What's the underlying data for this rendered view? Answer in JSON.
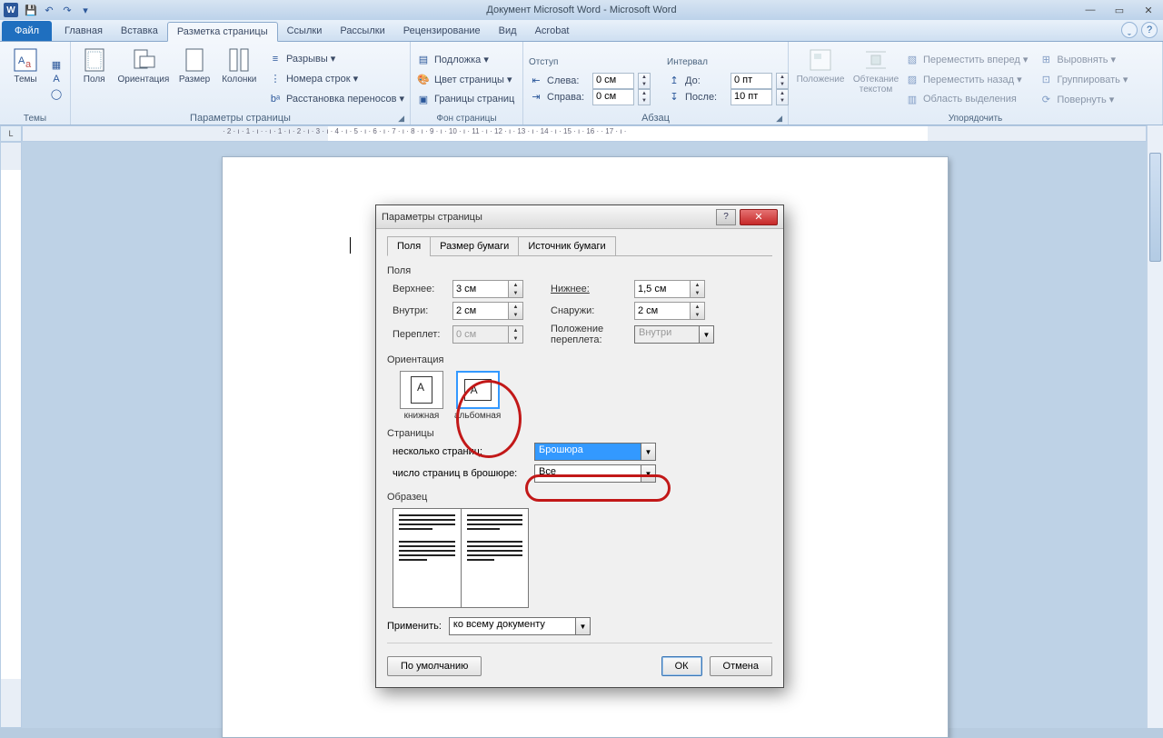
{
  "titlebar": {
    "title": "Документ Microsoft Word  -  Microsoft Word"
  },
  "tabs": {
    "file": "Файл",
    "items": [
      "Главная",
      "Вставка",
      "Разметка страницы",
      "Ссылки",
      "Рассылки",
      "Рецензирование",
      "Вид",
      "Acrobat"
    ],
    "activeIndex": 2
  },
  "ribbon": {
    "themes": {
      "title": "Темы",
      "themes_btn": "Темы"
    },
    "pageSetup": {
      "title": "Параметры страницы",
      "margins": "Поля",
      "orientation": "Ориентация",
      "size": "Размер",
      "columns": "Колонки",
      "breaks": "Разрывы ▾",
      "lineNumbers": "Номера строк ▾",
      "hyphenation": "Расстановка переносов ▾"
    },
    "pageBg": {
      "title": "Фон страницы",
      "watermark": "Подложка ▾",
      "pageColor": "Цвет страницы ▾",
      "borders": "Границы страниц"
    },
    "paragraph": {
      "title": "Абзац",
      "indentHeader": "Отступ",
      "spacingHeader": "Интервал",
      "leftLabel": "Слева:",
      "rightLabel": "Справа:",
      "beforeLabel": "До:",
      "afterLabel": "После:",
      "left": "0 см",
      "right": "0 см",
      "before": "0 пт",
      "after": "10 пт"
    },
    "arrange": {
      "title": "Упорядочить",
      "position": "Положение",
      "wrap": "Обтекание текстом",
      "bringFwd": "Переместить вперед ▾",
      "sendBack": "Переместить назад ▾",
      "selectionPane": "Область выделения",
      "align": "Выровнять ▾",
      "group": "Группировать ▾",
      "rotate": "Повернуть ▾"
    }
  },
  "ruler": {
    "h": "· 2 · ı · 1 · ı ·   · ı · 1 · ı · 2 · ı · 3 · ı · 4 · ı · 5 · ı · 6 · ı · 7 · ı · 8 · ı · 9 · ı · 10 · ı · 11 · ı · 12 · ı · 13 · ı · 14 · ı · 15 · ı · 16 ·   · 17 · ı ·"
  },
  "dialog": {
    "title": "Параметры страницы",
    "tabs": [
      "Поля",
      "Размер бумаги",
      "Источник бумаги"
    ],
    "activeTab": 0,
    "margins": {
      "header": "Поля",
      "top": {
        "label": "Верхнее:",
        "value": "3 см"
      },
      "bottom": {
        "label": "Нижнее:",
        "value": "1,5 см"
      },
      "inside": {
        "label": "Внутри:",
        "value": "2 см"
      },
      "outside": {
        "label": "Снаружи:",
        "value": "2 см"
      },
      "gutter": {
        "label": "Переплет:",
        "value": "0 см"
      },
      "gutterPos": {
        "label": "Положение переплета:",
        "value": "Внутри"
      }
    },
    "orientation": {
      "header": "Ориентация",
      "portrait": "книжная",
      "landscape": "альбомная"
    },
    "pages": {
      "header": "Страницы",
      "multiLabel": "несколько страниц:",
      "multiValue": "Брошюра",
      "sheetsLabel": "число страниц в брошюре:",
      "sheetsValue": "Все"
    },
    "preview": {
      "header": "Образец"
    },
    "applyTo": {
      "label": "Применить:",
      "value": "ко всему документу"
    },
    "buttons": {
      "default": "По умолчанию",
      "ok": "ОК",
      "cancel": "Отмена"
    }
  }
}
